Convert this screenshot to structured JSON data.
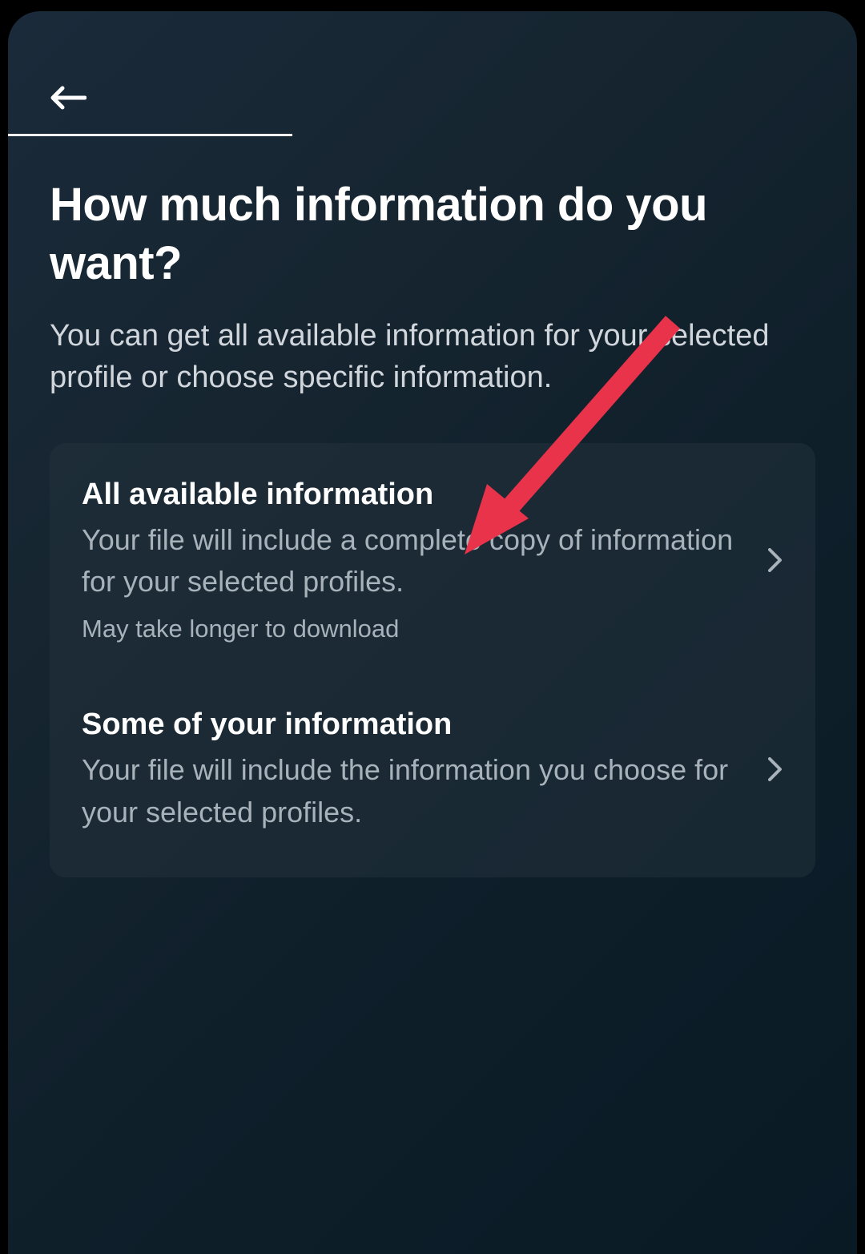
{
  "page": {
    "title": "How much information do you want?",
    "subtitle": "You can get all available information for your selected profile or choose specific information."
  },
  "options": [
    {
      "title": "All available information",
      "description": "Your file will include a complete copy of information for your selected profiles.",
      "note": "May take longer to download"
    },
    {
      "title": "Some of your information",
      "description": "Your file will include the information you choose for your selected profiles."
    }
  ]
}
